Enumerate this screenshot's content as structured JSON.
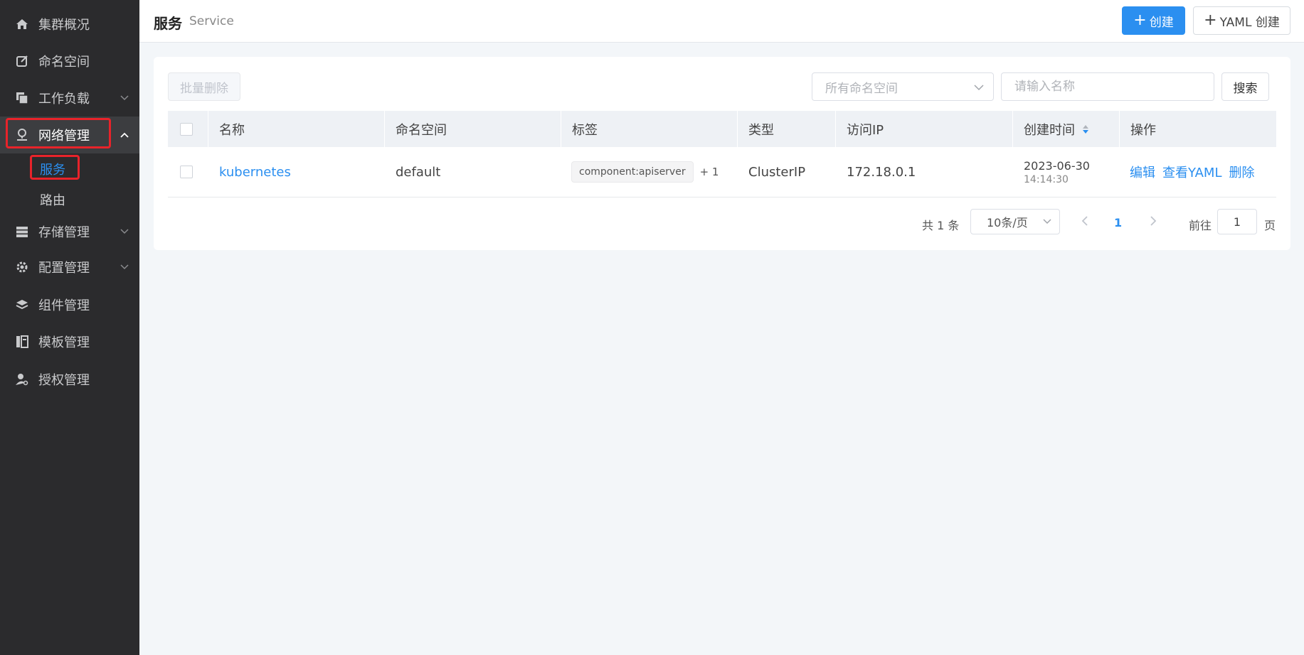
{
  "sidebar": {
    "items": [
      {
        "label": "集群概况",
        "icon": "home-icon"
      },
      {
        "label": "命名空间",
        "icon": "edit-icon"
      },
      {
        "label": "工作负载",
        "icon": "copy-icon"
      },
      {
        "label": "网络管理",
        "icon": "network-icon"
      },
      {
        "label": "存储管理",
        "icon": "storage-icon"
      },
      {
        "label": "配置管理",
        "icon": "gear-icon"
      },
      {
        "label": "组件管理",
        "icon": "layers-icon"
      },
      {
        "label": "模板管理",
        "icon": "template-icon"
      },
      {
        "label": "授权管理",
        "icon": "user-key-icon"
      }
    ],
    "network_sub": [
      {
        "label": "服务"
      },
      {
        "label": "路由"
      }
    ]
  },
  "header": {
    "title": "服务",
    "subtitle": "Service",
    "create_label": "创建",
    "yaml_create_label": "YAML 创建"
  },
  "toolbar": {
    "batch_delete_label": "批量删除",
    "namespace_placeholder": "所有命名空间",
    "search_placeholder": "请输入名称",
    "search_button": "搜索"
  },
  "table": {
    "columns": [
      "名称",
      "命名空间",
      "标签",
      "类型",
      "访问IP",
      "创建时间",
      "操作"
    ],
    "rows": [
      {
        "name": "kubernetes",
        "namespace": "default",
        "label_tag": "component:apiserver",
        "label_more": "+ 1",
        "type": "ClusterIP",
        "ip": "172.18.0.1",
        "created_date": "2023-06-30",
        "created_time": "14:14:30",
        "actions": [
          "编辑",
          "查看YAML",
          "删除"
        ]
      }
    ]
  },
  "pagination": {
    "total": "共 1 条",
    "page_size": "10条/页",
    "current_page": "1",
    "goto_prefix": "前往",
    "goto_value": "1",
    "goto_suffix": "页"
  },
  "colors": {
    "primary": "#2b8ff0",
    "sidebar_bg": "#2b2b2d",
    "highlight_box": "#e8232a"
  }
}
